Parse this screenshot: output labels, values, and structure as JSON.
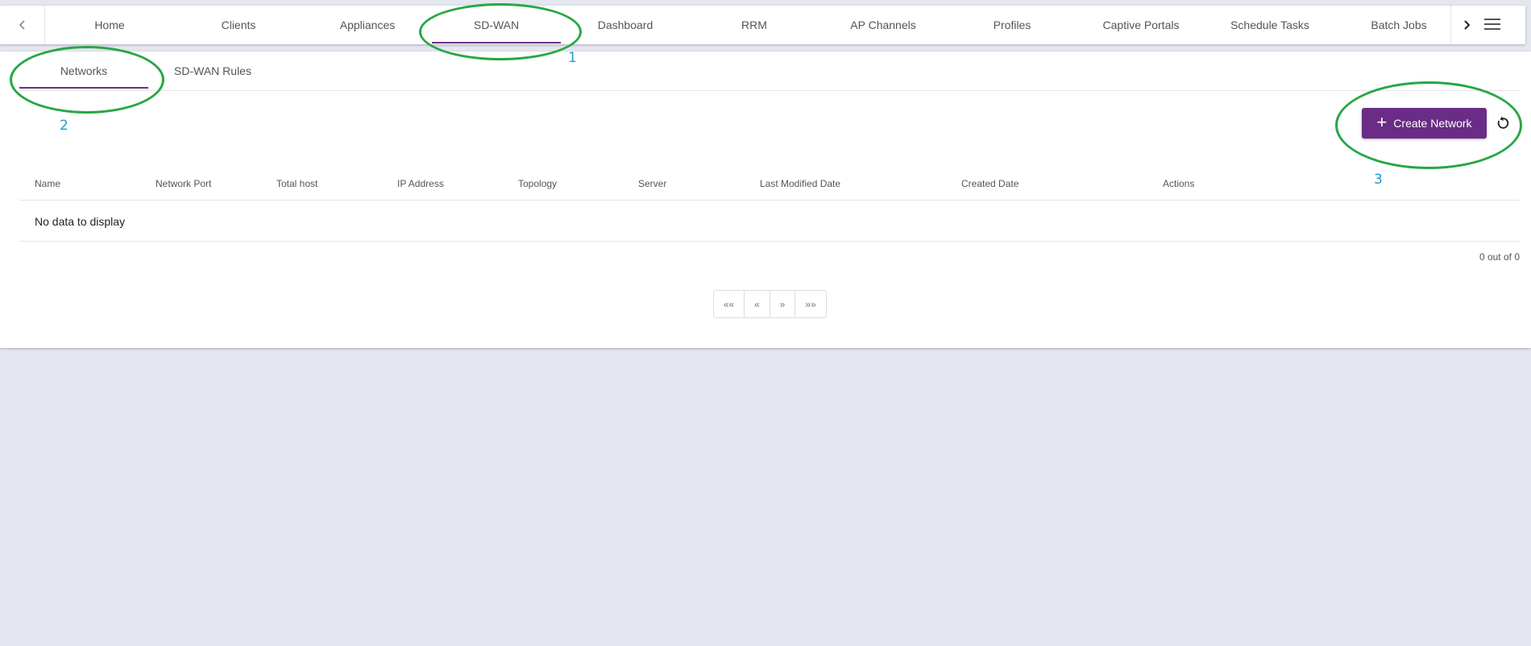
{
  "nav": {
    "tabs": [
      {
        "label": "Home",
        "active": false
      },
      {
        "label": "Clients",
        "active": false
      },
      {
        "label": "Appliances",
        "active": false
      },
      {
        "label": "SD-WAN",
        "active": true
      },
      {
        "label": "Dashboard",
        "active": false
      },
      {
        "label": "RRM",
        "active": false
      },
      {
        "label": "AP Channels",
        "active": false
      },
      {
        "label": "Profiles",
        "active": false
      },
      {
        "label": "Captive Portals",
        "active": false
      },
      {
        "label": "Schedule Tasks",
        "active": false
      },
      {
        "label": "Batch Jobs",
        "active": false
      }
    ],
    "left_icon": "chevron-left-icon",
    "right_icon": "chevron-right-icon",
    "menu_icon": "hamburger-menu-icon"
  },
  "subtabs": [
    {
      "label": "Networks",
      "active": true
    },
    {
      "label": "SD-WAN Rules",
      "active": false
    }
  ],
  "toolbar": {
    "create_label": "Create Network",
    "create_icon": "plus-icon",
    "refresh_icon": "refresh-icon"
  },
  "table": {
    "columns": [
      "Name",
      "Network Port",
      "Total host",
      "IP Address",
      "Topology",
      "Server",
      "Last Modified Date",
      "Created Date",
      "Actions"
    ],
    "empty_text": "No data to display",
    "count_text": "0 out of 0"
  },
  "pagination": {
    "first": "««",
    "prev": "«",
    "next": "»",
    "last": "»»"
  },
  "annotations": [
    "1",
    "2",
    "3"
  ],
  "colors": {
    "accent": "#6a2c86",
    "annotation_ring": "#28a745",
    "annotation_number": "#1b9ad6",
    "page_bg": "#e4e7ef"
  }
}
